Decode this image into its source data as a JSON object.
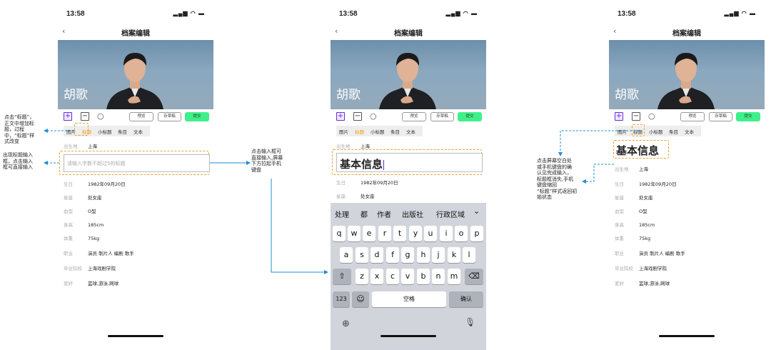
{
  "status": {
    "time": "13:58"
  },
  "nav": {
    "back": "‹",
    "title": "档案编辑"
  },
  "banner": {
    "name": "胡歌"
  },
  "toolbar": {
    "plus": "+",
    "minus": "−",
    "preview": "预览",
    "draft": "存草稿",
    "submit": "提交"
  },
  "tabs": [
    "图片",
    "标题",
    "小标题",
    "条目",
    "文本"
  ],
  "birthplace": {
    "label": "出生地",
    "value": "上海"
  },
  "input": {
    "placeholder": "请输入字数不超过5的标题",
    "typed": "基本信息"
  },
  "heading": "基本信息",
  "fields": [
    {
      "label": "生日",
      "value": "1982年09月20日"
    },
    {
      "label": "星座",
      "value": "处女座"
    },
    {
      "label": "血型",
      "value": "O型"
    },
    {
      "label": "身高",
      "value": "185cm"
    },
    {
      "label": "体重",
      "value": "75kg"
    },
    {
      "label": "职业",
      "value": "演员 制片人 编剧 歌手"
    },
    {
      "label": "毕业院校",
      "value": "上海戏剧学院"
    },
    {
      "label": "爱好",
      "value": "篮球,游泳,网球"
    }
  ],
  "keyboard": {
    "candidates": [
      "处理",
      "都",
      "作者",
      "出版社",
      "行政区域"
    ],
    "row1": [
      "q",
      "w",
      "e",
      "r",
      "t",
      "y",
      "u",
      "i",
      "o",
      "p"
    ],
    "row2": [
      "a",
      "s",
      "d",
      "f",
      "g",
      "h",
      "j",
      "k",
      "l"
    ],
    "row3": [
      "z",
      "x",
      "c",
      "v",
      "b",
      "n",
      "m"
    ],
    "numbers": "123",
    "space": "空格",
    "confirm": "确认"
  },
  "annotations": {
    "a1": "点击“标题”，\n正文中增加标\n题，过程\n中，“标题”样\n式改变",
    "a2": "出现标题输入\n框，点击输入\n框可直接输入",
    "a3": "点击输入框可\n直接输入,屏幕\n下方拉起手机\n键盘",
    "a4": "点击屏幕空白处\n或手机键盘的确\n认见完成输入，\n标题框消失,手机\n键盘缩回\n“标题”样式返回初\n始状态"
  }
}
